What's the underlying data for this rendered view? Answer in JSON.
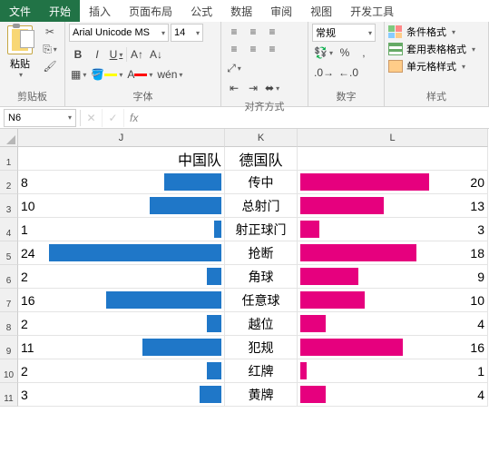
{
  "menu": {
    "file": "文件",
    "home": "开始",
    "insert": "插入",
    "layout": "页面布局",
    "formula": "公式",
    "data": "数据",
    "review": "审阅",
    "view": "视图",
    "dev": "开发工具"
  },
  "ribbon": {
    "clipboard": {
      "paste": "粘贴",
      "label": "剪贴板"
    },
    "font": {
      "name": "Arial Unicode MS",
      "size": "14",
      "label": "字体"
    },
    "align": {
      "label": "对齐方式"
    },
    "number": {
      "combo": "常规",
      "label": "数字"
    },
    "styles": {
      "cond": "条件格式",
      "table": "套用表格格式",
      "cell": "单元格样式",
      "label": "样式"
    }
  },
  "fbar": {
    "name": "N6",
    "fx": "fx"
  },
  "cols": {
    "J": "J",
    "K": "K",
    "L": "L"
  },
  "rows": [
    "1",
    "2",
    "3",
    "4",
    "5",
    "6",
    "7",
    "8",
    "9",
    "10",
    "11"
  ],
  "chart_data": {
    "type": "bar",
    "title_left": "中国队",
    "title_right": "德国队",
    "categories": [
      "传中",
      "总射门",
      "射正球门",
      "抢断",
      "角球",
      "任意球",
      "越位",
      "犯规",
      "红牌",
      "黄牌"
    ],
    "series": [
      {
        "name": "中国队",
        "values": [
          8,
          10,
          1,
          24,
          2,
          16,
          2,
          11,
          2,
          3
        ]
      },
      {
        "name": "德国队",
        "values": [
          20,
          13,
          3,
          18,
          9,
          10,
          4,
          16,
          1,
          4
        ]
      }
    ],
    "max": 24,
    "colors": {
      "left": "#1f77c8",
      "right": "#e6007e"
    }
  }
}
